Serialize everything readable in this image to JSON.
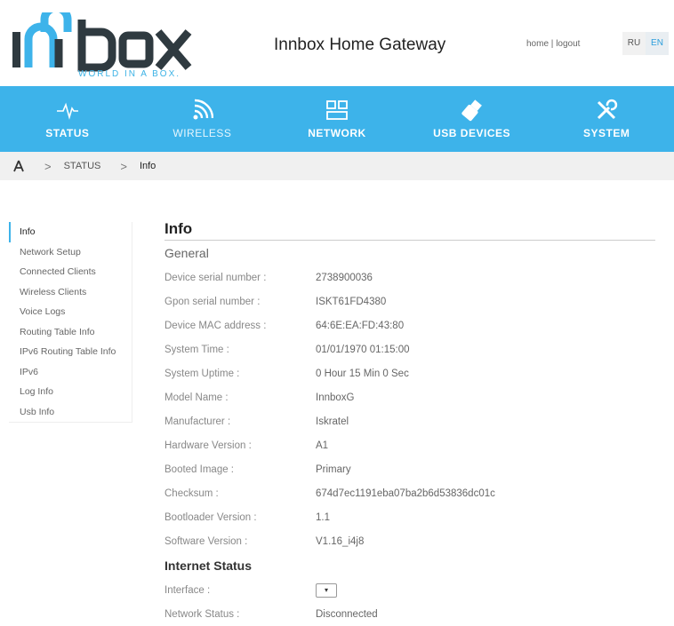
{
  "header": {
    "logo_text": "INNBOX",
    "logo_tagline": "WORLD IN A BOX.",
    "title": "Innbox Home Gateway",
    "home_link": "home",
    "link_sep": "|",
    "logout_link": "logout",
    "lang_ru": "RU",
    "lang_en": "EN"
  },
  "nav": {
    "items": [
      {
        "label": "STATUS",
        "icon": "pulse-icon"
      },
      {
        "label": "WIRELESS",
        "icon": "wifi-icon"
      },
      {
        "label": "NETWORK",
        "icon": "network-icon"
      },
      {
        "label": "USB DEVICES",
        "icon": "usb-icon"
      },
      {
        "label": "SYSTEM",
        "icon": "tools-icon"
      }
    ]
  },
  "breadcrumb": {
    "sep": ">",
    "level1": "STATUS",
    "current": "Info"
  },
  "sidebar": {
    "items": [
      "Info",
      "Network Setup",
      "Connected Clients",
      "Wireless Clients",
      "Voice Logs",
      "Routing Table Info",
      "IPv6 Routing Table Info",
      "IPv6",
      "Log Info",
      "Usb Info"
    ]
  },
  "main": {
    "title": "Info",
    "general_heading": "General",
    "general": [
      {
        "label": "Device serial number :",
        "value": "2738900036"
      },
      {
        "label": "Gpon serial number :",
        "value": "ISKT61FD4380"
      },
      {
        "label": "Device MAC address :",
        "value": "64:6E:EA:FD:43:80"
      },
      {
        "label": "System Time :",
        "value": "01/01/1970 01:15:00"
      },
      {
        "label": "System Uptime :",
        "value": "0 Hour 15 Min 0 Sec"
      },
      {
        "label": "Model Name :",
        "value": "InnboxG"
      },
      {
        "label": "Manufacturer :",
        "value": "Iskratel"
      },
      {
        "label": "Hardware Version :",
        "value": "A1"
      },
      {
        "label": "Booted Image :",
        "value": "Primary"
      },
      {
        "label": "Checksum :",
        "value": "674d7ec1191eba07ba2b6d53836dc01c"
      },
      {
        "label": "Bootloader Version :",
        "value": "1.1"
      },
      {
        "label": "Software Version :",
        "value": "V1.16_i4j8"
      }
    ],
    "internet_heading": "Internet Status",
    "interface_label": "Interface :",
    "interface_select": "▾",
    "network_status_label": "Network Status :",
    "network_status_value": "Disconnected"
  },
  "colors": {
    "accent": "#3db3ea",
    "breadcrumb_bg": "#f0f0f0"
  }
}
